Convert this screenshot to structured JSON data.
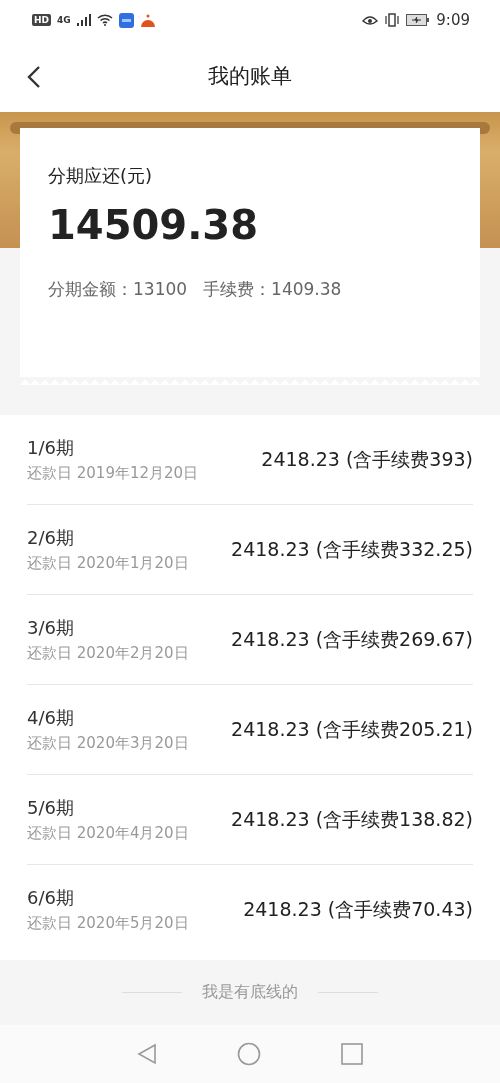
{
  "status_bar": {
    "hd": "HD",
    "network": "4G",
    "time": "9:09"
  },
  "header": {
    "title": "我的账单"
  },
  "summary": {
    "label": "分期应还(元)",
    "total": "14509.38",
    "principal_label": "分期金额：",
    "principal": "13100",
    "fee_label": "手续费：",
    "fee": "1409.38"
  },
  "installments": [
    {
      "period": "1/6期",
      "due": "还款日 2019年12月20日",
      "amount": "2418.23 (含手续费393)"
    },
    {
      "period": "2/6期",
      "due": "还款日 2020年1月20日",
      "amount": "2418.23 (含手续费332.25)"
    },
    {
      "period": "3/6期",
      "due": "还款日 2020年2月20日",
      "amount": "2418.23 (含手续费269.67)"
    },
    {
      "period": "4/6期",
      "due": "还款日 2020年3月20日",
      "amount": "2418.23 (含手续费205.21)"
    },
    {
      "period": "5/6期",
      "due": "还款日 2020年4月20日",
      "amount": "2418.23 (含手续费138.82)"
    },
    {
      "period": "6/6期",
      "due": "还款日 2020年5月20日",
      "amount": "2418.23 (含手续费70.43)"
    }
  ],
  "footer": {
    "text": "我是有底线的"
  }
}
